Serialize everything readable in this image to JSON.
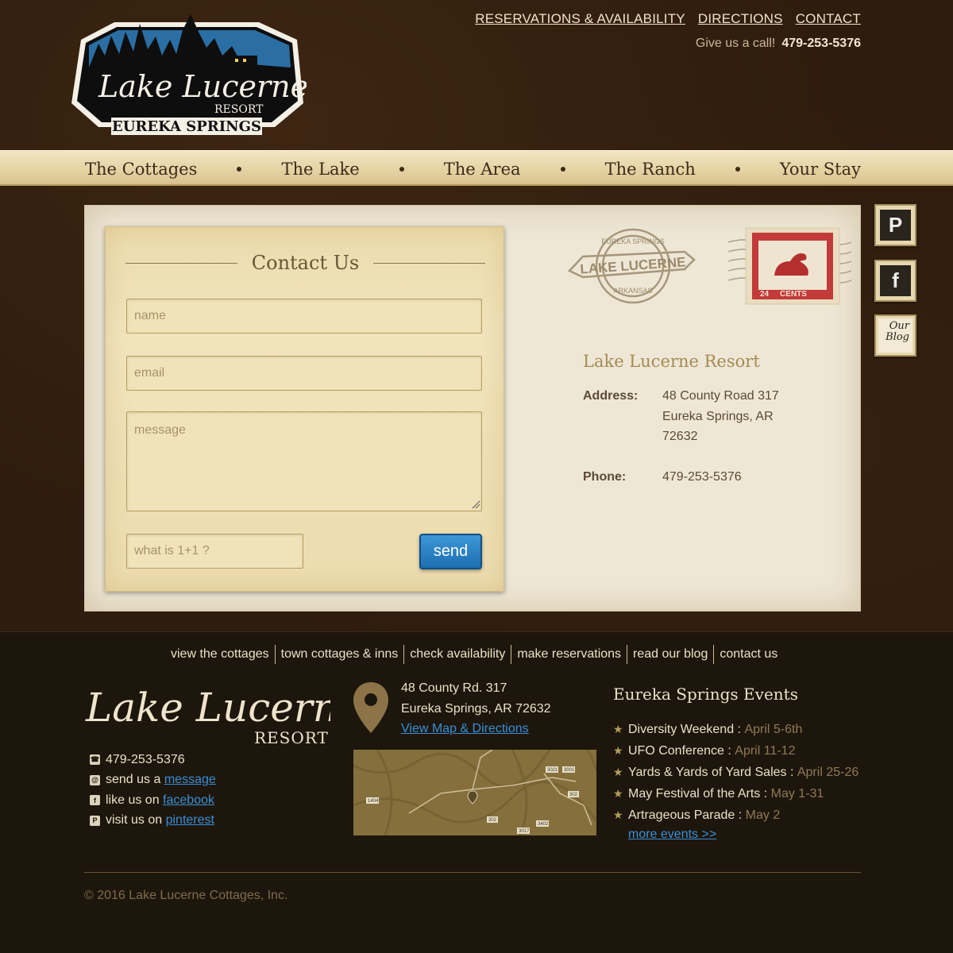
{
  "header": {
    "logo": {
      "script": "Lake Lucerne",
      "resort": "RESORT",
      "place": "EUREKA SPRINGS"
    },
    "top_links": [
      "RESERVATIONS & AVAILABILITY",
      "DIRECTIONS",
      "CONTACT"
    ],
    "call_label": "Give us a call!",
    "call_number": "479-253-5376"
  },
  "nav": {
    "items": [
      "The Cottages",
      "The Lake",
      "The Area",
      "The Ranch",
      "Your Stay"
    ]
  },
  "form": {
    "title": "Contact Us",
    "name_placeholder": "name",
    "email_placeholder": "email",
    "message_placeholder": "message",
    "captcha_placeholder": "what is 1+1 ?",
    "send_label": "send"
  },
  "postmark": {
    "top": "EUREKA SPRINGS",
    "middle": "LAKE LUCERNE",
    "bottom": "ARKANSAS"
  },
  "stamp": {
    "text": "CENTS",
    "value": "24"
  },
  "info": {
    "title": "Lake Lucerne Resort",
    "address_label": "Address:",
    "address_lines": [
      "48 County Road 317",
      "Eureka Springs, AR",
      "72632"
    ],
    "phone_label": "Phone:",
    "phone": "479-253-5376"
  },
  "social": {
    "pinterest": "P",
    "facebook": "f",
    "blog_line1": "Our",
    "blog_line2": "Blog"
  },
  "footer": {
    "links": [
      "view the cottages",
      "town cottages & inns",
      "check availability",
      "make reservations",
      "read our blog",
      "contact us"
    ],
    "logo": {
      "script": "Lake Lucerne",
      "resort": "RESORT"
    },
    "phone": "479-253-5376",
    "message_prefix": "send us a",
    "message_link": "message",
    "facebook_prefix": "like us on",
    "facebook_link": "facebook",
    "pinterest_prefix": "visit us on",
    "pinterest_link": "pinterest",
    "address_line1": "48 County Rd. 317",
    "address_line2": "Eureka Springs, AR  72632",
    "map_link": "View Map & Directions",
    "map_labels": [
      "3021",
      "3001",
      "302",
      "1404",
      "302",
      "3402",
      "3017"
    ],
    "events_title": "Eureka Springs Events",
    "events": [
      {
        "name": "Diversity Weekend :",
        "date": "April 5-6th"
      },
      {
        "name": "UFO Conference :",
        "date": "April 11-12"
      },
      {
        "name": "Yards & Yards of Yard Sales :",
        "date": "April 25-26"
      },
      {
        "name": "May Festival of the Arts :",
        "date": "May 1-31"
      },
      {
        "name": "Artrageous Parade :",
        "date": "May 2"
      }
    ],
    "more_events": "more events >>",
    "copyright": "© 2016 Lake Lucerne Cottages, Inc."
  }
}
